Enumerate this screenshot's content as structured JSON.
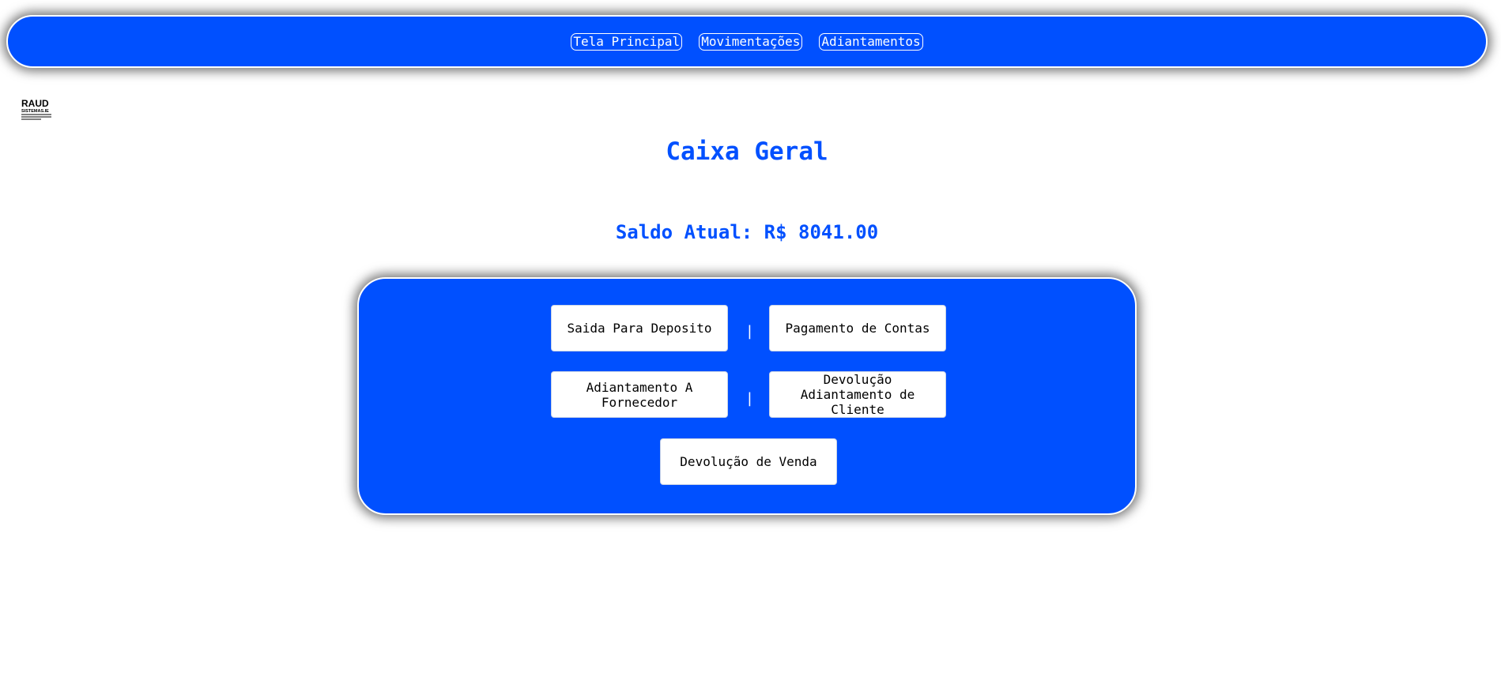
{
  "nav": {
    "links": [
      {
        "label": "Tela Principal"
      },
      {
        "label": "Movimentações"
      },
      {
        "label": "Adiantamentos"
      }
    ]
  },
  "logo": {
    "line1": "RAUD",
    "line2": "SISTEMAS.IE"
  },
  "page": {
    "title": "Caixa Geral",
    "balance": "Saldo Atual: R$ 8041.00"
  },
  "actions": {
    "saida_deposito": "Saida Para Deposito",
    "pagamento_contas": "Pagamento de Contas",
    "adiantamento_fornecedor": "Adiantamento A Fornecedor",
    "devolucao_adiantamento_cliente": "Devolução Adiantamento de Cliente",
    "devolucao_venda": "Devolução de Venda",
    "separator": "|"
  },
  "colors": {
    "brand_blue": "#0050ff",
    "white": "#ffffff"
  }
}
